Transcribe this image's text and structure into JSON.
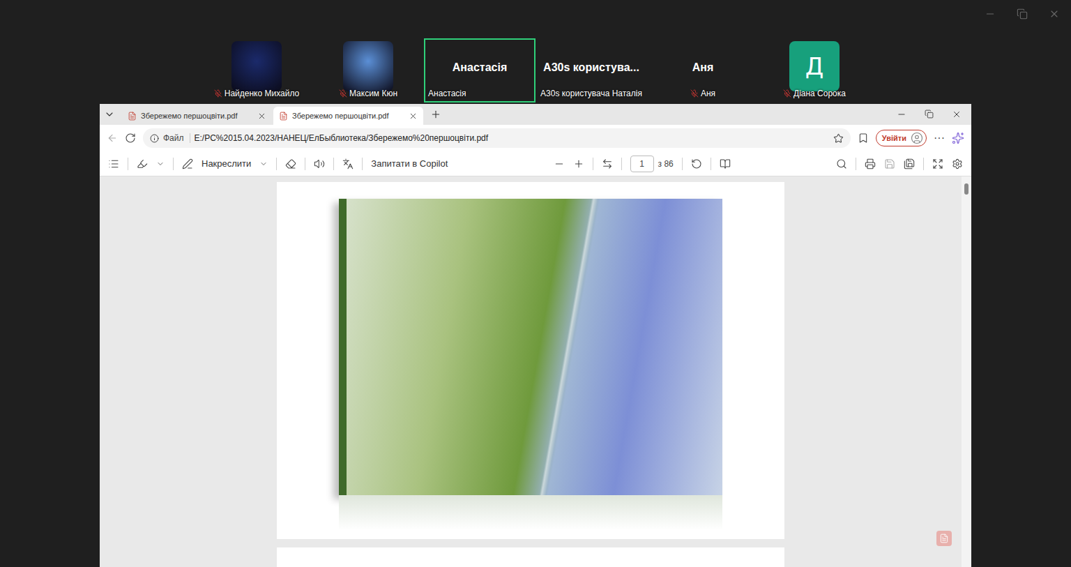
{
  "participants": [
    {
      "name": "Найденко Михайло",
      "kind": "video",
      "muted": true,
      "selected": false,
      "color": "#1b2a6b"
    },
    {
      "name": "Максим Кюн",
      "kind": "video",
      "muted": true,
      "selected": false,
      "color": "#5b8fd6"
    },
    {
      "name": "Анастасія",
      "kind": "name",
      "display": "Анастасія",
      "muted": false,
      "selected": true
    },
    {
      "name": "A30s користувача Наталія",
      "kind": "name",
      "display": "A30s користува...",
      "muted": false,
      "selected": false
    },
    {
      "name": "Аня",
      "kind": "name",
      "display": "Аня",
      "muted": true,
      "selected": false
    },
    {
      "name": "Діана Сорока",
      "kind": "initial",
      "display": "Д",
      "muted": true,
      "selected": false,
      "color": "#17a07c"
    }
  ],
  "browser": {
    "tabs": [
      {
        "label": "Збережемо першоцвіти.pdf",
        "selected": false
      },
      {
        "label": "Збережемо першоцвіти.pdf",
        "selected": true
      }
    ],
    "address": {
      "scheme": "Файл",
      "url": "E:/PC%2015.04.2023/НАНЕЦ/ЕлБыблиотека/Збережемо%20першоцвіти.pdf"
    },
    "sign_in": "Увійти",
    "more": "···"
  },
  "pdf_toolbar": {
    "draw": "Накреслити",
    "ask": "Запитати в Copilot",
    "page": "1",
    "page_count": "з 86"
  },
  "document": {
    "scroll_level": 0
  }
}
